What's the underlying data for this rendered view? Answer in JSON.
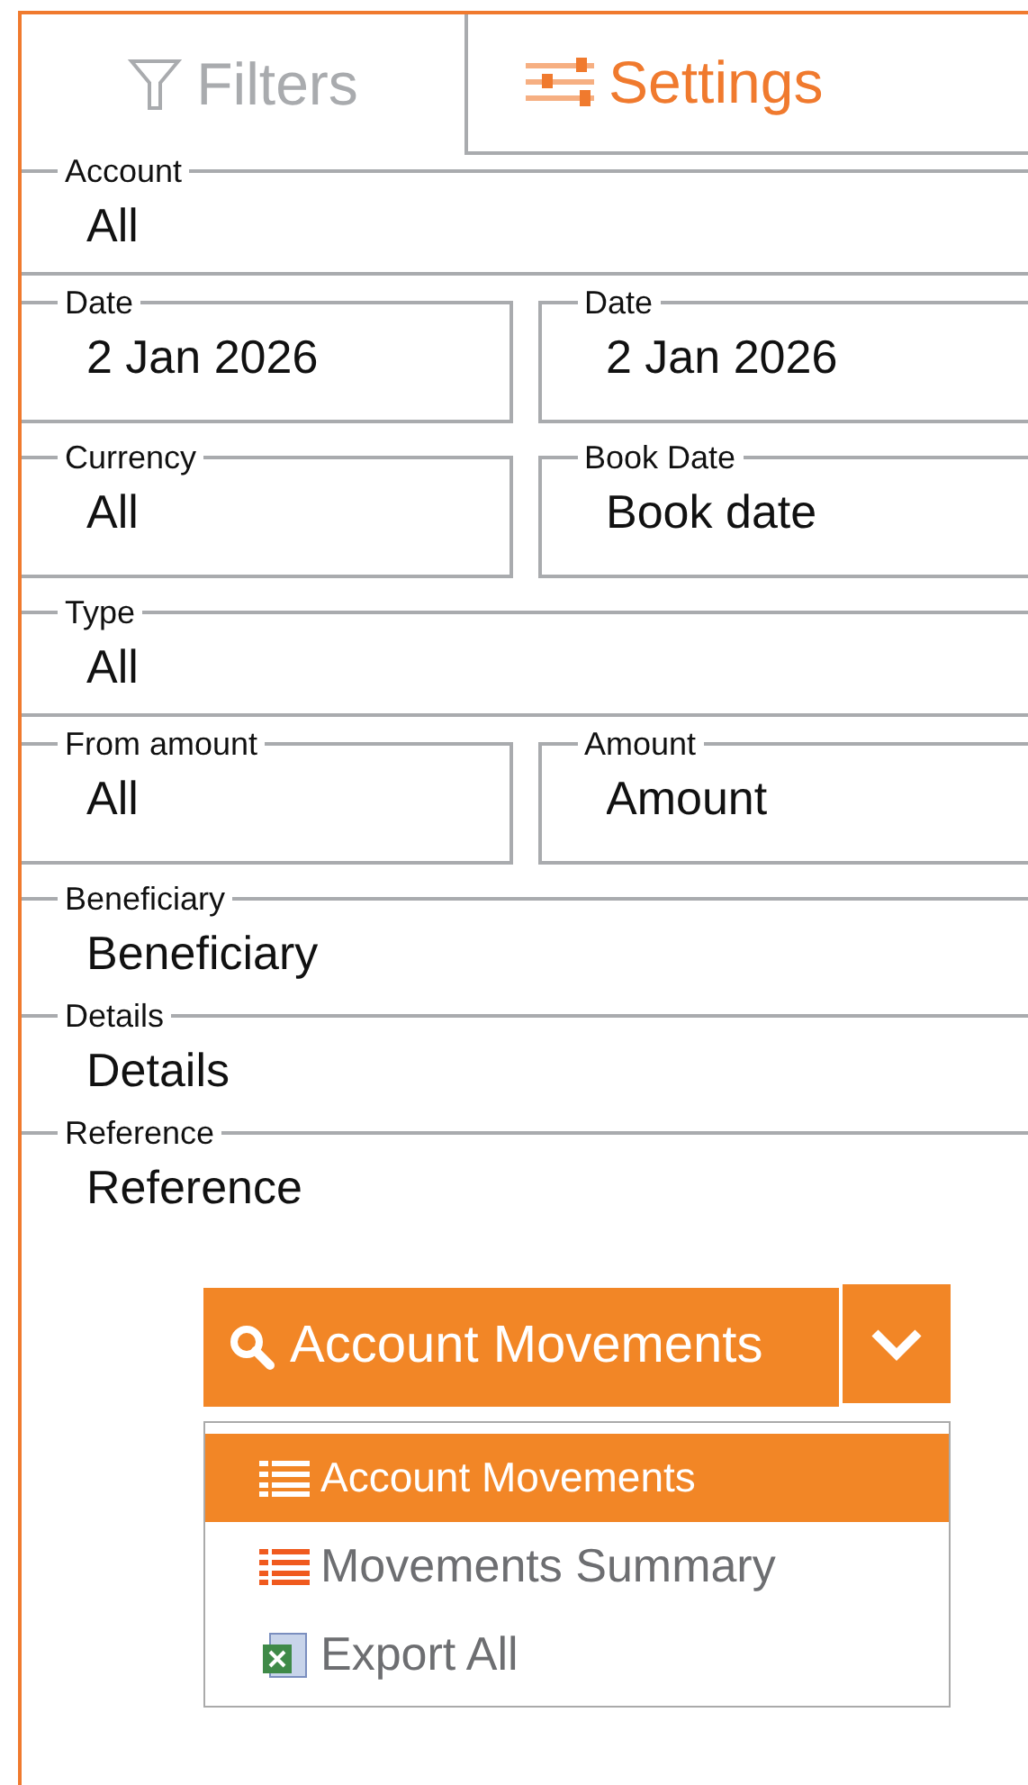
{
  "tabs": [
    {
      "label": "Filters",
      "kind": "filter",
      "selected": false
    },
    {
      "label": "Settings",
      "kind": "settings",
      "selected": true
    }
  ],
  "fields": [
    {
      "label": "Account",
      "value": "All",
      "kind": "full"
    },
    {
      "label": "Date",
      "value": "2 Jan 2026",
      "kind": "half"
    },
    {
      "label": "Date",
      "value": "2 Jan 2026",
      "kind": "half"
    },
    {
      "label": "Currency",
      "value": "All",
      "kind": "half"
    },
    {
      "label": "Book Date",
      "placeholder": "Book date",
      "kind": "half"
    },
    {
      "label": "Type",
      "value": "All",
      "kind": "full"
    },
    {
      "label": "From amount",
      "value": "All",
      "kind": "half"
    },
    {
      "label": "Amount",
      "placeholder": "Amount",
      "kind": "half"
    },
    {
      "label": "Beneficiary",
      "placeholder": "Beneficiary",
      "kind": "full"
    },
    {
      "label": "Details",
      "placeholder": "Details",
      "kind": "full"
    },
    {
      "label": "Reference",
      "placeholder": "Reference",
      "kind": "full"
    }
  ],
  "action": {
    "label": "Account Movements"
  },
  "menu": [
    {
      "label": "Account Movements",
      "kind": "list",
      "selected": true
    },
    {
      "label": "Movements Summary",
      "kind": "list",
      "selected": false
    },
    {
      "label": "Export All",
      "kind": "sheet",
      "selected": false
    }
  ]
}
